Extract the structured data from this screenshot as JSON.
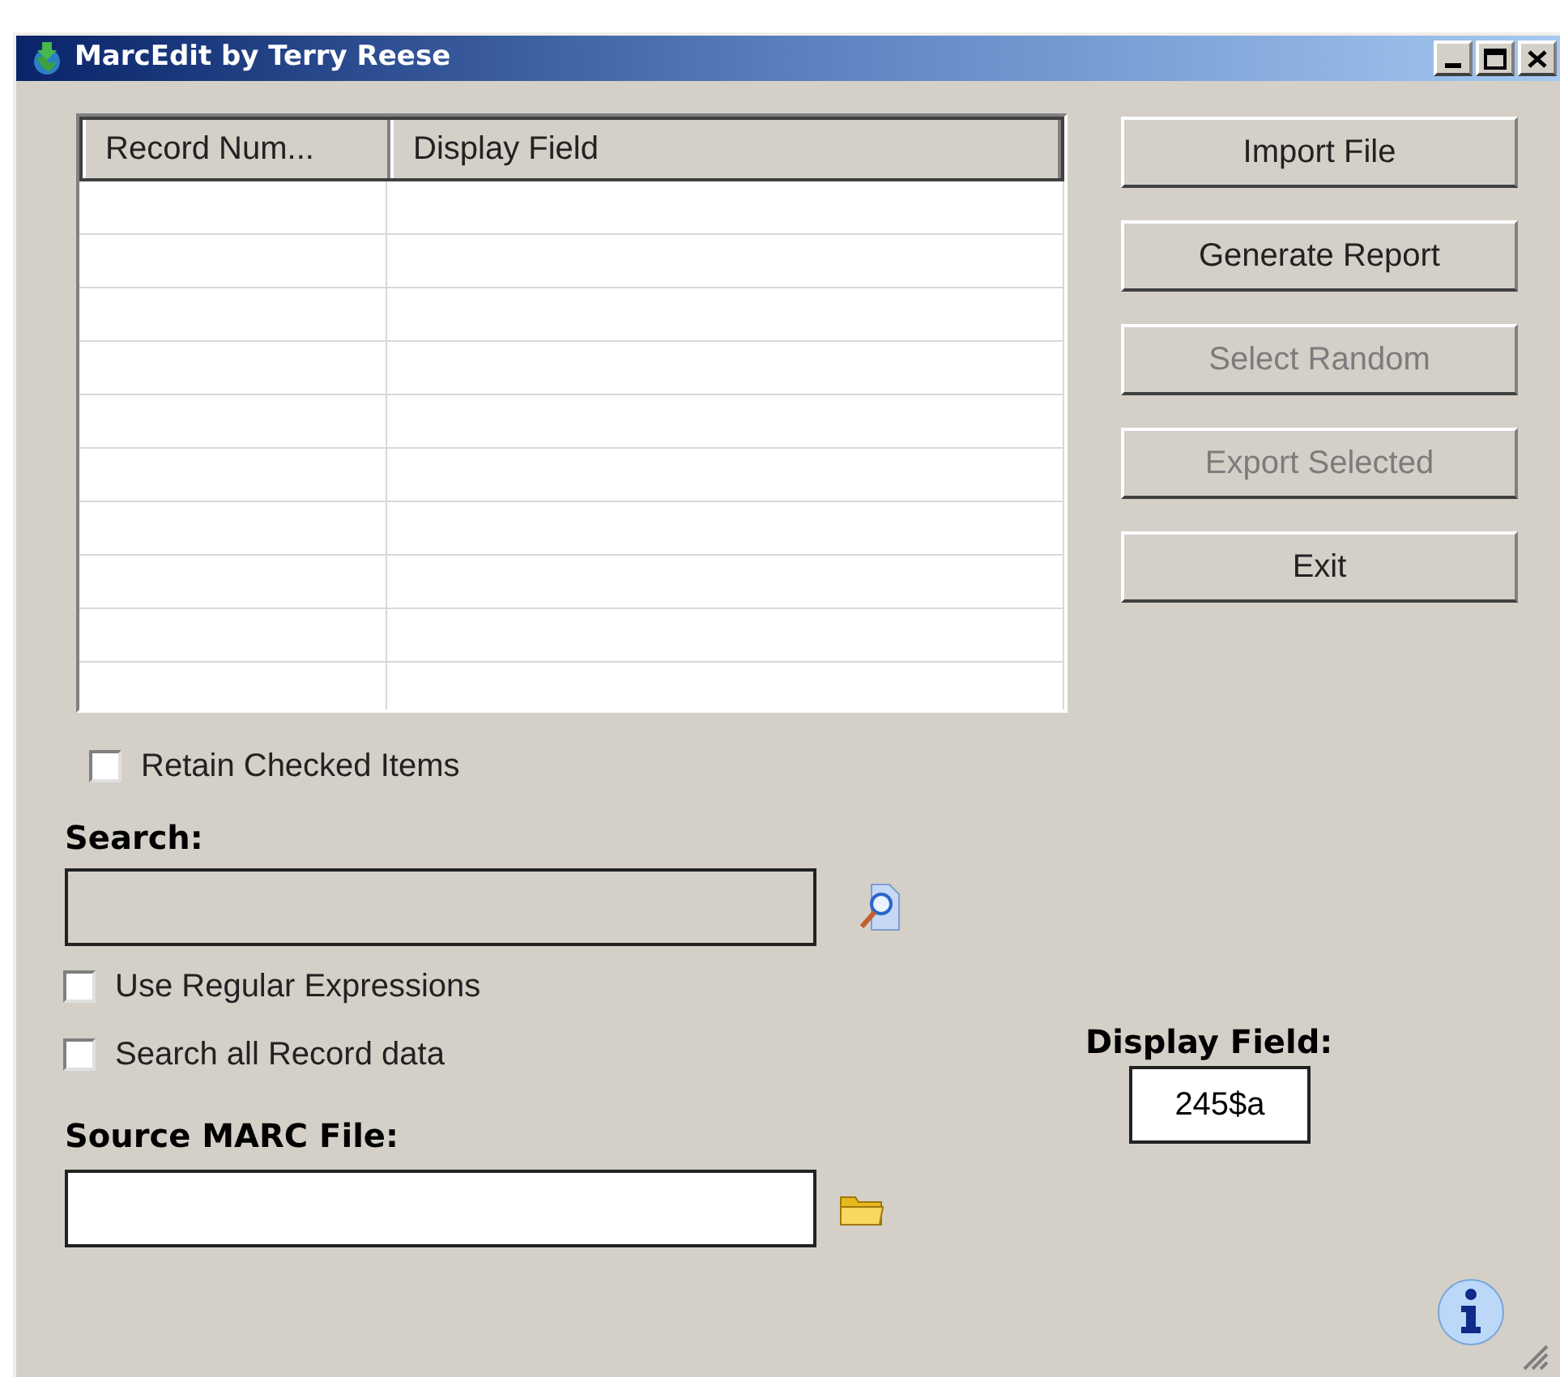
{
  "window": {
    "title": "MarcEdit by Terry Reese"
  },
  "table": {
    "columns": [
      "Record Num...",
      "Display Field"
    ]
  },
  "buttons": [
    {
      "label": "Import File",
      "disabled": false
    },
    {
      "label": "Generate Report",
      "disabled": false
    },
    {
      "label": "Select Random",
      "disabled": true
    },
    {
      "label": "Export Selected",
      "disabled": true
    },
    {
      "label": "Exit",
      "disabled": false
    }
  ],
  "retain_checked": {
    "label": "Retain Checked Items",
    "checked": false
  },
  "search": {
    "label": "Search:",
    "disabled": true
  },
  "search_options": [
    {
      "label": "Use Regular Expressions",
      "checked": false
    },
    {
      "label": "Search all Record data",
      "checked": false
    }
  ],
  "source": {
    "label": "Source MARC File:"
  },
  "display_field": {
    "label": "Display Field:",
    "value": "245$a"
  }
}
